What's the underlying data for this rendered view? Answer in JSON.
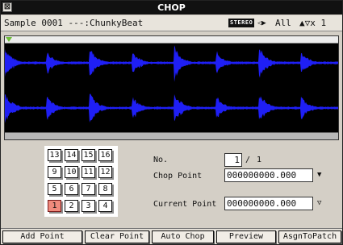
{
  "window": {
    "title": "CHOP",
    "close_glyph": "⊠"
  },
  "infobar": {
    "sample": "Sample 0001 ---:ChunkyBeat",
    "stereo_badge": "STEREO",
    "nav_arrows": "◁▶",
    "view": "All",
    "zoom": "▲▽x 1"
  },
  "waveform": {
    "color": "#1f1ff5",
    "background": "#000000"
  },
  "pads": {
    "labels": [
      "13",
      "14",
      "15",
      "16",
      "9",
      "10",
      "11",
      "12",
      "5",
      "6",
      "7",
      "8",
      "1",
      "2",
      "3",
      "4"
    ],
    "selected": "1"
  },
  "fields": {
    "no_label": "No.",
    "no_value": "1",
    "no_sep": "/",
    "no_total": "1",
    "chop_point_label": "Chop Point",
    "chop_point_value": "000000000.000",
    "current_point_label": "Current Point",
    "current_point_value": "000000000.000"
  },
  "buttons": {
    "add_point": "Add Point",
    "clear_point": "Clear Point",
    "auto_chop": "Auto Chop",
    "preview": "Preview",
    "assign": "AsgnToPatch"
  },
  "colors": {
    "selected_pad": "#f08a7c",
    "marker": "#6fbe3a"
  }
}
